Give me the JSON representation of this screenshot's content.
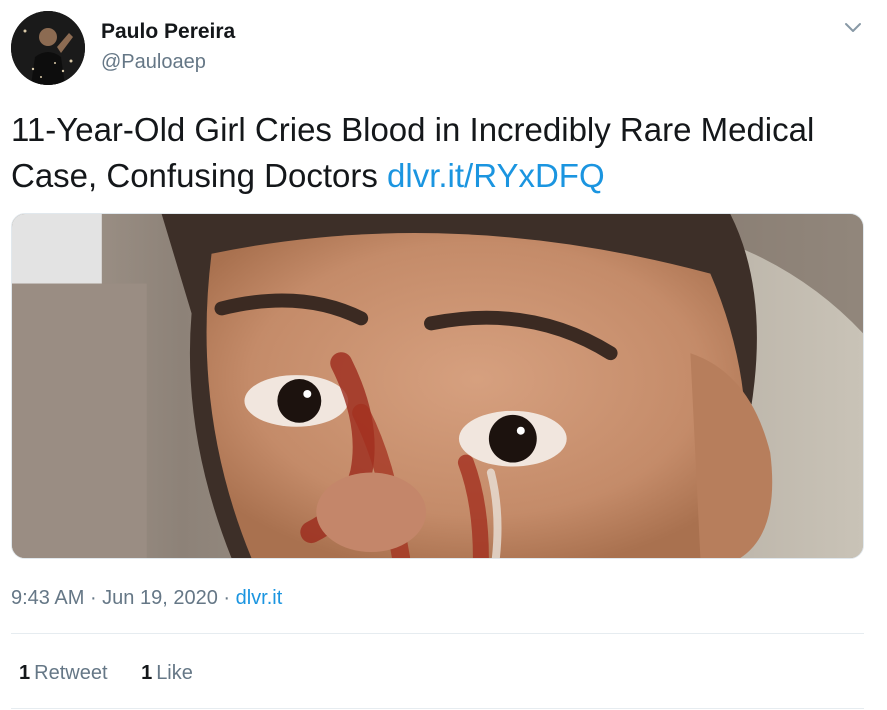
{
  "author": {
    "name": "Paulo Pereira",
    "handle": "@Pauloaep",
    "avatar_icon": "avatar-photo"
  },
  "menu": {
    "icon": "chevron-down-icon"
  },
  "tweet": {
    "text": "11-Year-Old Girl Cries Blood in Incredibly Rare Medical Case, Confusing Doctors ",
    "link_text": "dlvr.it/RYxDFQ"
  },
  "media": {
    "alt": "Close-up photo of a girl with blood streaks running from her eyes"
  },
  "meta": {
    "time": "9:43 AM",
    "separator1": " · ",
    "date": "Jun 19, 2020",
    "separator2": " · ",
    "source": "dlvr.it"
  },
  "stats": {
    "retweets_count": "1",
    "retweets_label": "Retweet",
    "likes_count": "1",
    "likes_label": "Like"
  },
  "colors": {
    "link": "#1b95e0",
    "secondary_text": "#657786",
    "primary_text": "#14171a",
    "divider": "#e6ecf0"
  }
}
